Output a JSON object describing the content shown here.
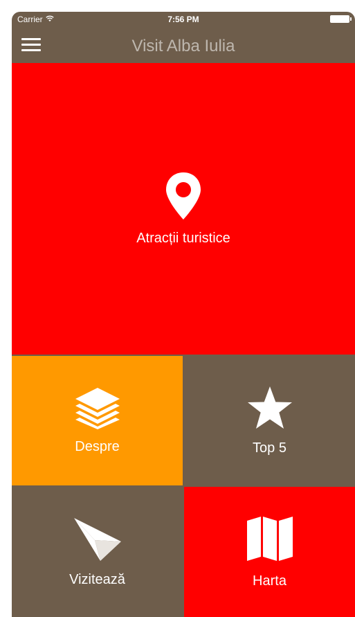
{
  "status_bar": {
    "carrier": "Carrier",
    "time": "7:56 PM"
  },
  "nav": {
    "title": "Visit Alba Iulia",
    "menu_icon": "hamburger-menu-icon"
  },
  "tiles": [
    {
      "label": "Atracții turistice",
      "icon": "map-pin-icon",
      "color": "#ff0000"
    },
    {
      "label": "Despre",
      "icon": "layers-icon",
      "color": "#ff9900"
    },
    {
      "label": "Top 5",
      "icon": "star-icon",
      "color": "#6e5d4b"
    },
    {
      "label": "Vizitează",
      "icon": "paper-plane-icon",
      "color": "#6e5d4b"
    },
    {
      "label": "Harta",
      "icon": "map-icon",
      "color": "#ff0000"
    }
  ],
  "colors": {
    "header": "#6e5d4b",
    "accent_red": "#ff0000",
    "accent_orange": "#ff9900",
    "divider": "#e8e4df"
  }
}
